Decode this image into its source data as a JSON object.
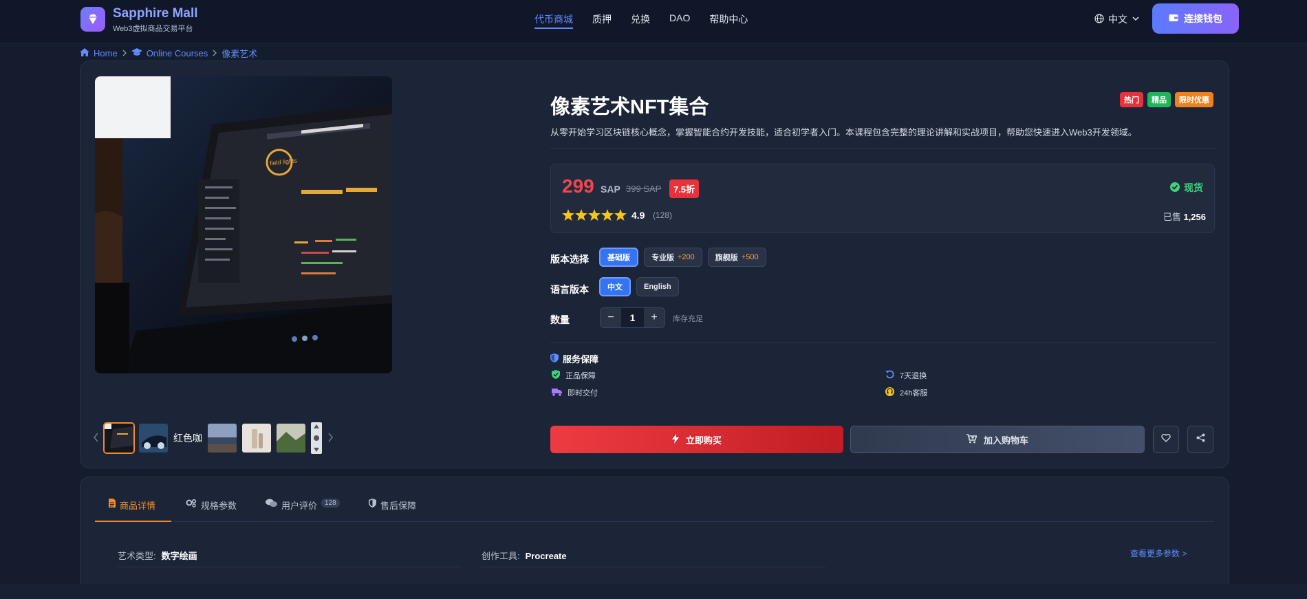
{
  "header": {
    "brand_name": "Sapphire Mall",
    "brand_sub": "Web3虚拟商品交易平台",
    "nav": [
      {
        "label": "代币商城",
        "active": true
      },
      {
        "label": "质押",
        "active": false
      },
      {
        "label": "兑换",
        "active": false
      },
      {
        "label": "DAO",
        "active": false
      },
      {
        "label": "帮助中心",
        "active": false
      }
    ],
    "language": "中文",
    "wallet_button": "连接钱包"
  },
  "breadcrumb": {
    "home": "Home",
    "category": "Online Courses",
    "current": "像素艺术"
  },
  "gallery": {
    "thumb_alt_text": "红色咖"
  },
  "product": {
    "title": "像素艺术NFT集合",
    "tags": [
      {
        "label": "热门",
        "color": "#e7323c"
      },
      {
        "label": "精品",
        "color": "#22b45a"
      },
      {
        "label": "限时优惠",
        "color": "#f0801c"
      }
    ],
    "description": "从零开始学习区块链核心概念，掌握智能合约开发技能，适合初学者入门。本课程包含完整的理论讲解和实战项目，帮助您快速进入Web3开发领域。",
    "price": "299",
    "currency": "SAP",
    "old_price": "399 SAP",
    "discount": "7.5折",
    "stock_status": "现货",
    "rating": "4.9",
    "rating_stars": 5,
    "review_count": "(128)",
    "sold_label": "已售",
    "sold_count": "1,256"
  },
  "options": {
    "version_label": "版本选择",
    "versions": [
      {
        "label": "基础版",
        "extra": "",
        "selected": true
      },
      {
        "label": "专业版",
        "extra": "+200",
        "selected": false
      },
      {
        "label": "旗舰版",
        "extra": "+500",
        "selected": false
      }
    ],
    "language_label": "语言版本",
    "languages": [
      {
        "label": "中文",
        "selected": true
      },
      {
        "label": "English",
        "selected": false
      }
    ],
    "quantity_label": "数量",
    "quantity": "1",
    "minus": "−",
    "plus": "+",
    "stock_note": "库存充足"
  },
  "service": {
    "title": "服务保障",
    "items": [
      {
        "label": "正品保障",
        "icon": "shield-check-icon",
        "color": "#3dd37a"
      },
      {
        "label": "7天退换",
        "icon": "undo-icon",
        "color": "#5f8cff"
      },
      {
        "label": "即时交付",
        "icon": "truck-icon",
        "color": "#a97bff"
      },
      {
        "label": "24h客服",
        "icon": "headset-icon",
        "color": "#f5c518"
      }
    ]
  },
  "actions": {
    "buy_now": "立即购买",
    "add_to_cart": "加入购物车"
  },
  "details": {
    "tabs": [
      {
        "label": "商品详情",
        "icon": "file-icon",
        "active": true,
        "count": ""
      },
      {
        "label": "规格参数",
        "icon": "gears-icon",
        "active": false,
        "count": ""
      },
      {
        "label": "用户评价",
        "icon": "comments-icon",
        "active": false,
        "count": "128"
      },
      {
        "label": "售后保障",
        "icon": "shield-icon",
        "active": false,
        "count": ""
      }
    ],
    "params": [
      {
        "label": "艺术类型:",
        "value": "数字绘画"
      },
      {
        "label": "创作工具:",
        "value": "Procreate"
      }
    ],
    "more_link": "查看更多参数 >"
  }
}
